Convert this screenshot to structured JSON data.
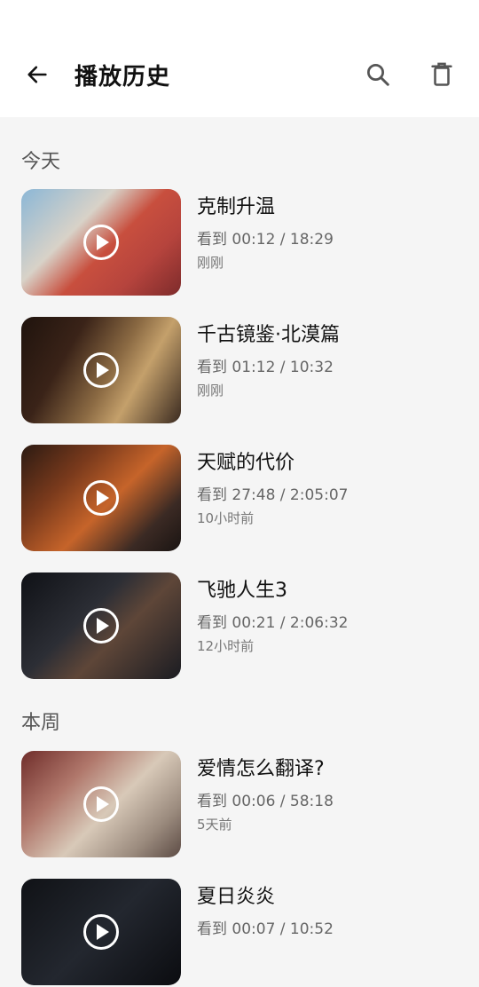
{
  "header": {
    "title": "播放历史",
    "back_icon": "arrow-left-icon",
    "search_icon": "search-icon",
    "delete_icon": "trash-icon"
  },
  "sections": [
    {
      "label": "今天",
      "items": [
        {
          "title": "克制升温",
          "progress": "看到 00:12 / 18:29",
          "time": "刚刚"
        },
        {
          "title": "千古镜鉴·北漠篇",
          "progress": "看到 01:12 / 10:32",
          "time": "刚刚"
        },
        {
          "title": "天赋的代价",
          "progress": "看到 27:48 / 2:05:07",
          "time": "10小时前"
        },
        {
          "title": "飞驰人生3",
          "progress": "看到 00:21 / 2:06:32",
          "time": "12小时前"
        }
      ]
    },
    {
      "label": "本周",
      "items": [
        {
          "title": "爱情怎么翻译?",
          "progress": "看到 00:06 / 58:18",
          "time": "5天前"
        },
        {
          "title": "夏日炎炎",
          "progress": "看到 00:07 / 10:52",
          "time": ""
        }
      ]
    }
  ]
}
